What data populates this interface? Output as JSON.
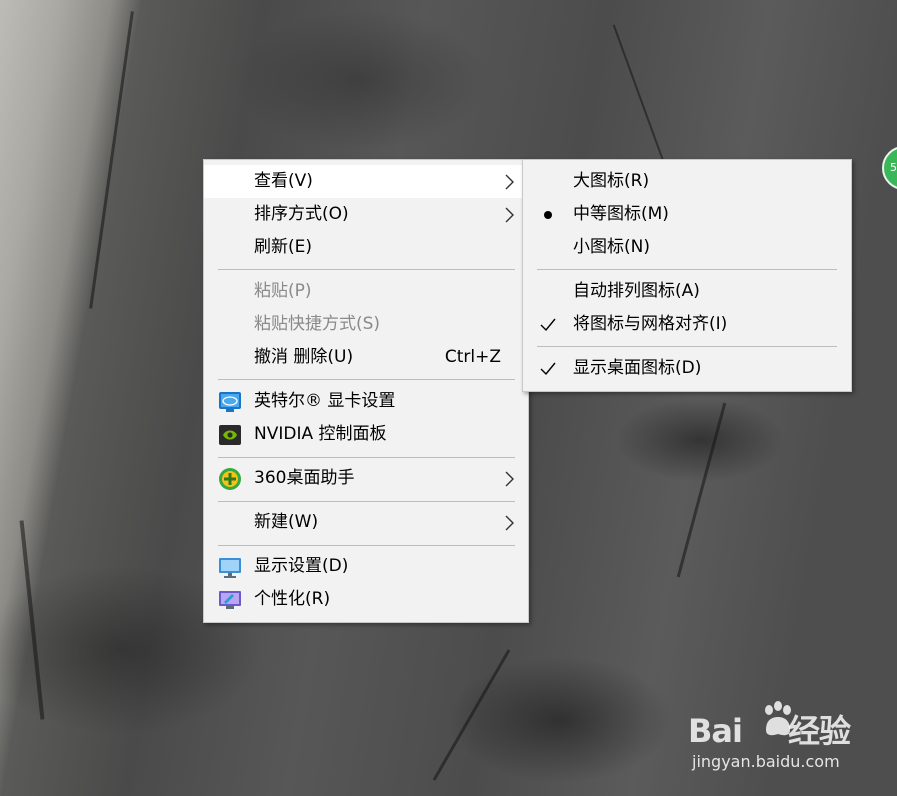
{
  "main_menu": {
    "view": "查看(V)",
    "sort": "排序方式(O)",
    "refresh": "刷新(E)",
    "paste": "粘贴(P)",
    "paste_shortcut": "粘贴快捷方式(S)",
    "undo": "撤消 删除(U)",
    "undo_shortcut": "Ctrl+Z",
    "intel": "英特尔® 显卡设置",
    "nvidia": "NVIDIA 控制面板",
    "assistant360": "360桌面助手",
    "new": "新建(W)",
    "display": "显示设置(D)",
    "personalize": "个性化(R)"
  },
  "view_submenu": {
    "large_icons": "大图标(R)",
    "medium_icons": "中等图标(M)",
    "small_icons": "小图标(N)",
    "auto_arrange": "自动排列图标(A)",
    "align_grid": "将图标与网格对齐(I)",
    "show_desktop_icons": "显示桌面图标(D)"
  },
  "badge_text": "5",
  "watermark": {
    "logo_left": "Bai",
    "logo_right": "经验",
    "url": "jingyan.baidu.com"
  },
  "icons": {
    "submenu_arrow": "chevron-right-icon",
    "selected_view": "bullet-icon",
    "checked": "checkmark-icon",
    "intel": "intel-graphics-icon",
    "nvidia": "nvidia-icon",
    "assistant360": "360-plus-icon",
    "display": "monitor-icon",
    "personalize": "personalize-monitor-icon"
  },
  "colors": {
    "menu_bg": "#f2f2f2",
    "highlight": "#ffffff",
    "disabled_text": "#8a8a8a",
    "badge_green": "#3bb75a"
  }
}
